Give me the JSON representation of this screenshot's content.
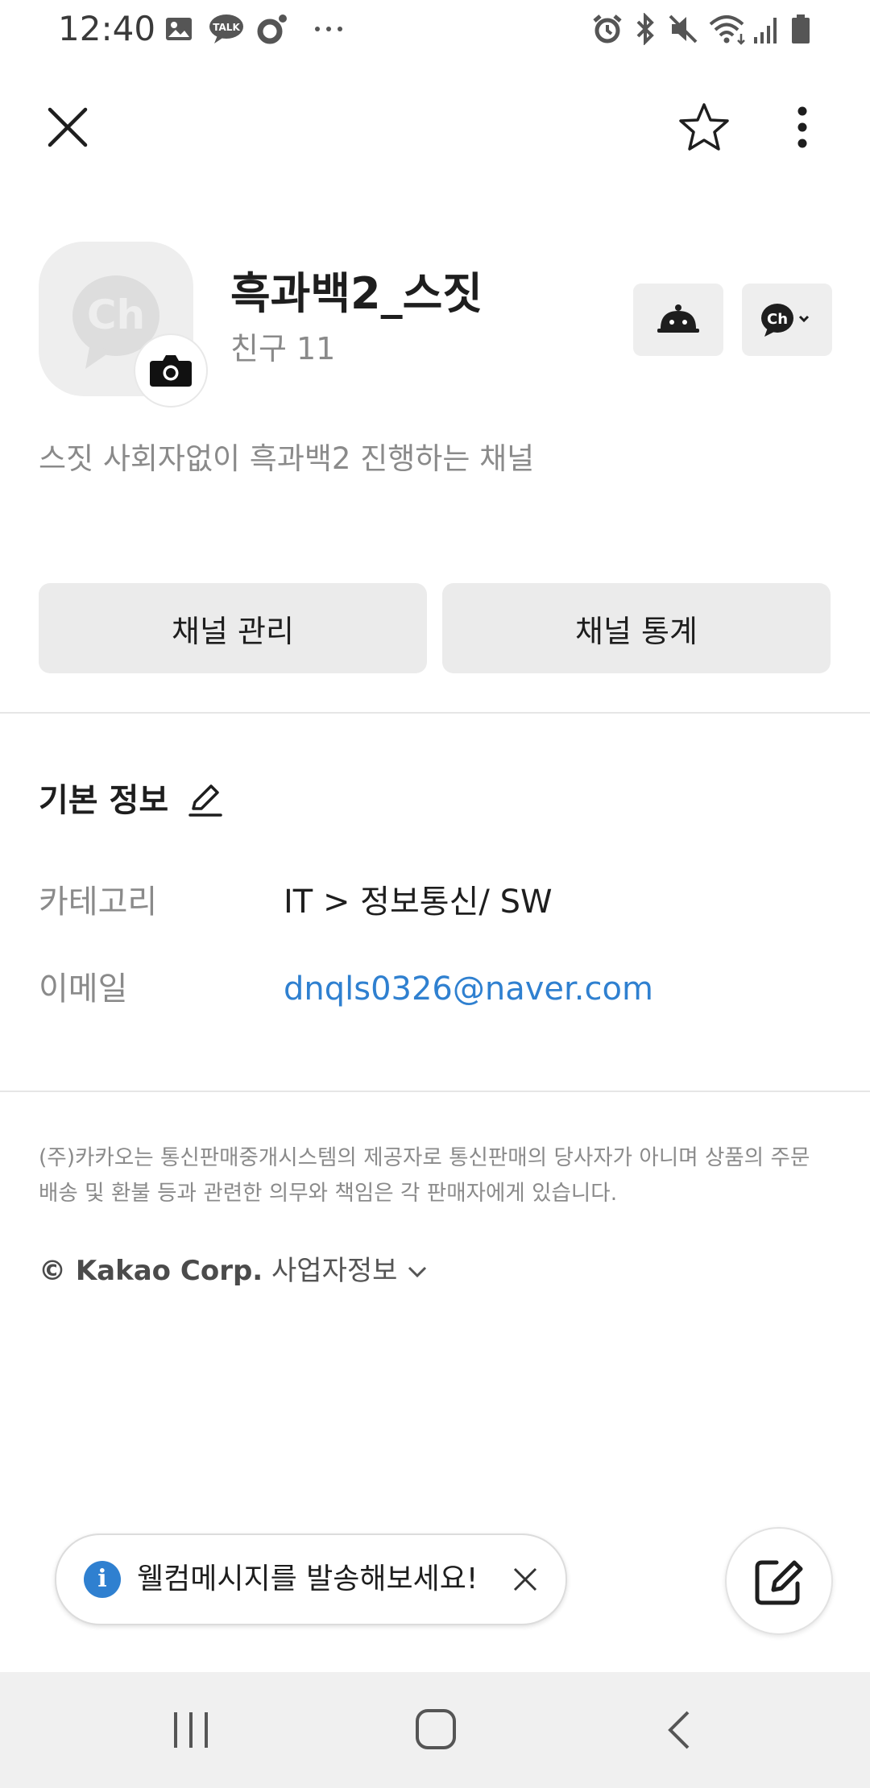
{
  "status_bar": {
    "time": "12:40",
    "left_icons": [
      "gallery-icon",
      "talk-icon",
      "ring-icon",
      "more-notifications-icon"
    ],
    "right_icons": [
      "alarm-icon",
      "bluetooth-icon",
      "mute-icon",
      "wifi-icon",
      "signal-icon",
      "battery-icon"
    ]
  },
  "header": {
    "close_icon": "close-icon",
    "star_icon": "star-icon",
    "menu_icon": "more-vertical-icon"
  },
  "profile": {
    "name": "흑과백2_스짓",
    "friends": "친구 11",
    "description": "스짓 사회자없이 흑과백2 진행하는 채널",
    "avatar_text": "Ch"
  },
  "actions": {
    "manage": "채널 관리",
    "stats": "채널 통계"
  },
  "basic_info": {
    "title": "기본 정보",
    "rows": [
      {
        "label": "카테고리",
        "value": "IT > 정보통신/ SW"
      },
      {
        "label": "이메일",
        "value": "dnqls0326@naver.com"
      }
    ]
  },
  "footer": {
    "disclaimer": "(주)카카오는 통신판매중개시스템의 제공자로 통신판매의 당사자가 아니며 상품의 주문 배송 및 환불 등과 관련한 의무와 책임은 각 판매자에게 있습니다.",
    "copyright": "© Kakao Corp.",
    "business_info": "사업자정보"
  },
  "toast": {
    "message": "웰컴메시지를 발송해보세요!",
    "info": "i"
  },
  "colors": {
    "link": "#2f80d0",
    "button_bg": "#ebebeb",
    "muted_text": "#8a8a8a"
  }
}
